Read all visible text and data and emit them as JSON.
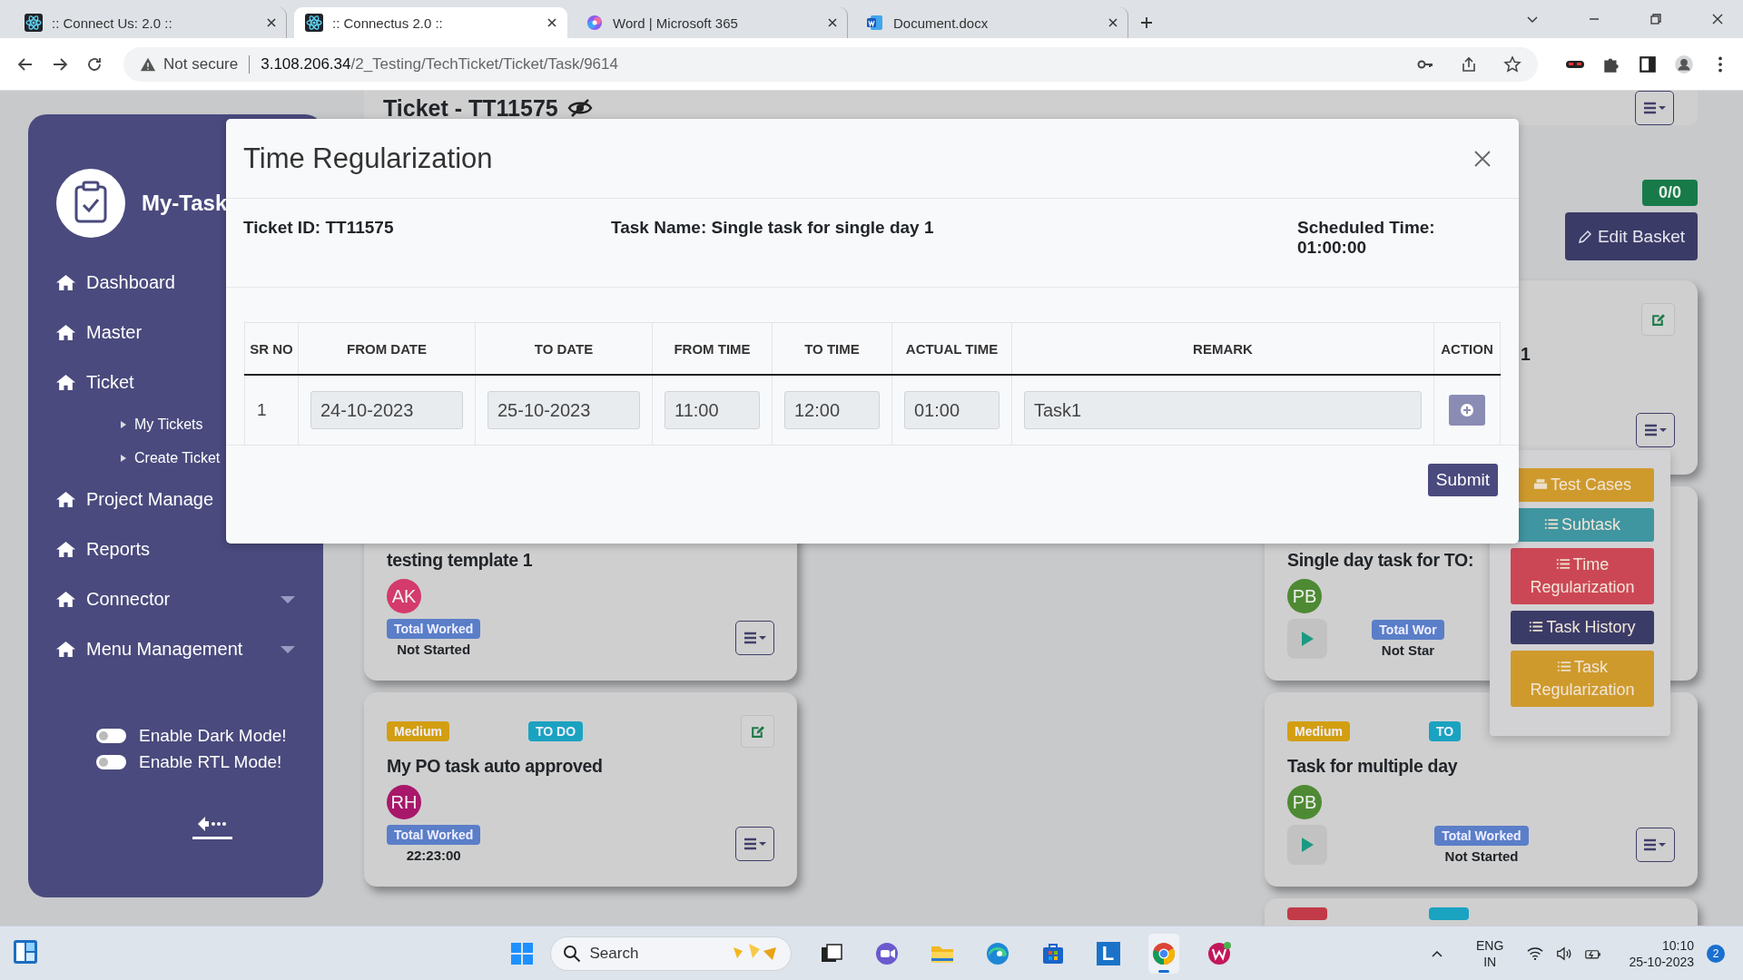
{
  "browser": {
    "tabs": [
      {
        "title": ":: Connect Us: 2.0 ::",
        "kind": "react",
        "selected": false
      },
      {
        "title": ":: Connectus 2.0 ::",
        "kind": "react",
        "selected": true
      },
      {
        "title": "Word | Microsoft 365",
        "kind": "office",
        "selected": false
      },
      {
        "title": "Document.docx",
        "kind": "word",
        "selected": false
      }
    ],
    "security": "Not secure",
    "host": "3.108.206.34",
    "path": "/2_Testing/TechTicket/Ticket/Task/9614"
  },
  "sidebar": {
    "brand": "My-Task",
    "items": [
      {
        "label": "Dashboard",
        "has_menu": false
      },
      {
        "label": "Master",
        "has_menu": false
      },
      {
        "label": "Ticket",
        "has_menu": false,
        "children": [
          {
            "label": "My Tickets"
          },
          {
            "label": "Create Ticket"
          }
        ]
      },
      {
        "label": "Project Manage",
        "has_menu": false
      },
      {
        "label": "Reports",
        "has_menu": false
      },
      {
        "label": "Connector",
        "has_menu": true
      },
      {
        "label": "Menu Management",
        "has_menu": true
      }
    ],
    "toggles": [
      {
        "label": "Enable Dark Mode!",
        "on": false
      },
      {
        "label": "Enable RTL Mode!",
        "on": false
      }
    ]
  },
  "page": {
    "title": "Ticket - TT11575",
    "progress": "0/0",
    "edit_button": "Edit Basket",
    "cards_left": [
      {
        "title": "testing template 1",
        "avatar": "AK",
        "color": "#d43a6c",
        "worked_label": "Total Worked",
        "worked_value": "Not Started",
        "playable": false,
        "edit": false,
        "menu": true
      },
      {
        "priority": "Medium",
        "status": "TO DO",
        "title": "My PO task auto approved",
        "avatar": "RH",
        "color": "#a8176a",
        "worked_label": "Total Worked",
        "worked_value": "22:23:00",
        "playable": false,
        "edit": true,
        "menu": true
      }
    ],
    "cards_right": [
      {
        "title": "1",
        "playable": false,
        "edit": true,
        "menu": true
      },
      {
        "title": "Single day task for TO:",
        "avatar": "PB",
        "color": "#4e8a33",
        "worked_label": "Total Wor",
        "worked_value": "Not Star",
        "playable": true,
        "edit": false,
        "menu": false
      },
      {
        "priority": "Medium",
        "status": "TO",
        "title": "Task for multiple day",
        "avatar": "PB",
        "color": "#4e8a33",
        "worked_label": "Total Worked",
        "worked_value": "Not Started",
        "playable": true,
        "edit": false,
        "menu": true
      }
    ]
  },
  "dropdown": {
    "items": [
      {
        "label": "Test Cases",
        "kind": "tray",
        "color": "#cf9a2c"
      },
      {
        "label": "Subtask",
        "kind": "list",
        "color": "#3f95a0"
      },
      {
        "label": "Time Regularization",
        "kind": "list",
        "color": "#cc4755"
      },
      {
        "label": "Task History",
        "kind": "list",
        "color": "#3b3b68"
      },
      {
        "label": "Task Regularization",
        "kind": "list",
        "color": "#cf9a2c"
      }
    ]
  },
  "modal": {
    "title": "Time Regularization",
    "ticket_id": "Ticket ID: TT11575",
    "task_name": "Task Name: Single task for single day 1",
    "scheduled": "Scheduled Time: 01:00:00",
    "columns": [
      "SR NO",
      "FROM DATE",
      "TO DATE",
      "FROM TIME",
      "TO TIME",
      "ACTUAL TIME",
      "REMARK",
      "ACTION"
    ],
    "rows": [
      {
        "sr": "1",
        "from_date": "24-10-2023",
        "to_date": "25-10-2023",
        "from_time": "11:00",
        "to_time": "12:00",
        "actual_time": "01:00",
        "remark": "Task1"
      }
    ],
    "submit": "Submit"
  },
  "taskbar": {
    "search": "Search",
    "apps": [
      {
        "kind": "taskview",
        "selected": false
      },
      {
        "kind": "meet",
        "selected": false
      },
      {
        "kind": "folder",
        "selected": false
      },
      {
        "kind": "edge",
        "selected": false
      },
      {
        "kind": "store",
        "selected": false
      },
      {
        "kind": "letter",
        "label": "L",
        "selected": false
      },
      {
        "kind": "chrome",
        "selected": true
      },
      {
        "kind": "office",
        "selected": false
      }
    ],
    "language": "ENG",
    "region": "IN",
    "time": "10:10",
    "date": "25-10-2023",
    "notifications": "2"
  }
}
